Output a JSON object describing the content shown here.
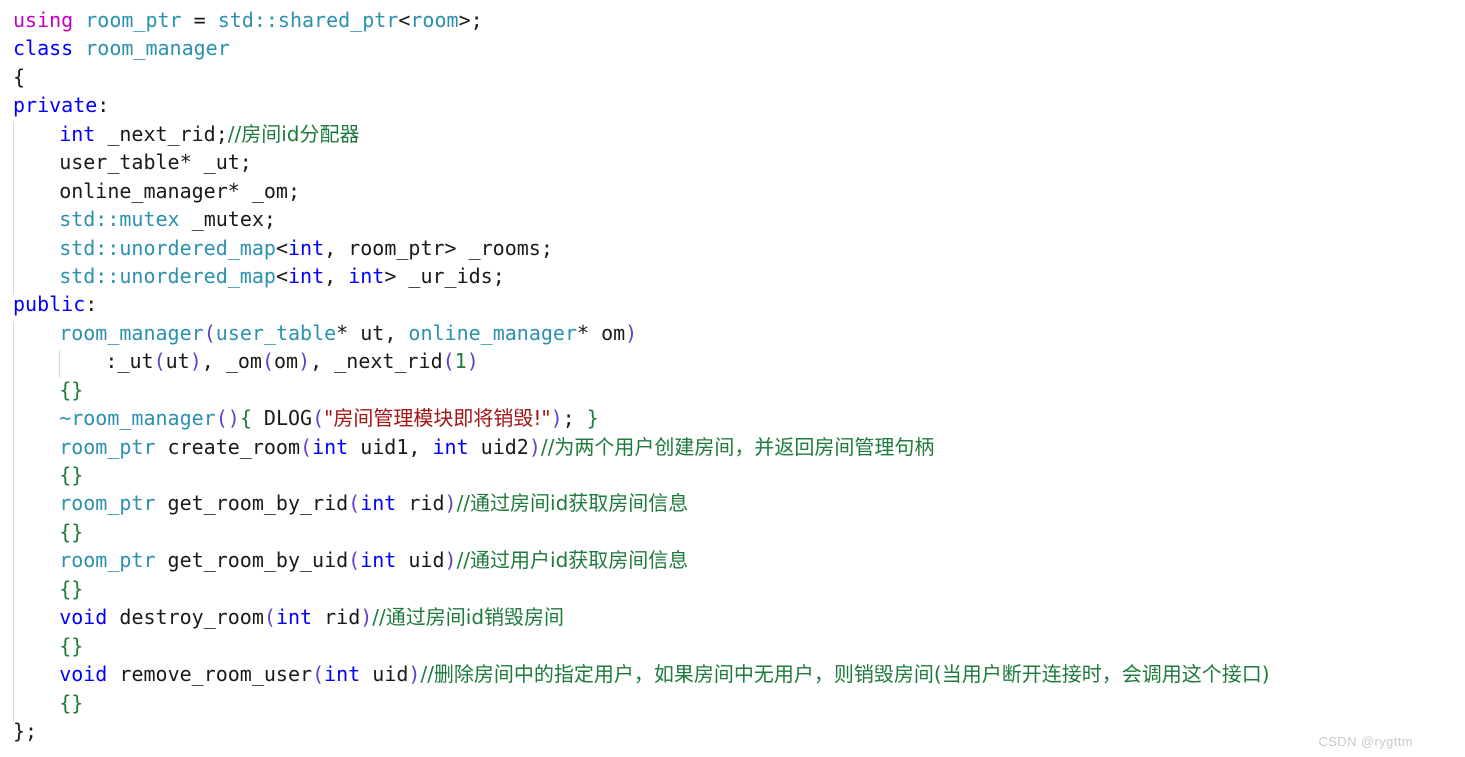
{
  "editor": {
    "language": "cpp",
    "background": "#ffffff",
    "colors": {
      "keyword": "#0000ff",
      "using_keyword": "#c500c5",
      "type": "#2b91af",
      "identifier": "#1a1a1a",
      "comment": "#1f7a3d",
      "string": "#a31515",
      "number": "#1f7a3d",
      "paren": "#5f41c9",
      "brace": "#1f7a3d",
      "indent_guide": "#d7d7d7",
      "watermark": "#c9c9c9"
    },
    "lines": [
      {
        "n": 1,
        "indent": 0,
        "tokens": [
          {
            "t": "using",
            "c": "kw-using"
          },
          {
            "t": " ",
            "c": "op"
          },
          {
            "t": "room_ptr",
            "c": "type"
          },
          {
            "t": " = ",
            "c": "punct"
          },
          {
            "t": "std::shared_ptr",
            "c": "type"
          },
          {
            "t": "<",
            "c": "punct"
          },
          {
            "t": "room",
            "c": "type"
          },
          {
            "t": ">;",
            "c": "punct"
          }
        ]
      },
      {
        "n": 2,
        "indent": 0,
        "tokens": [
          {
            "t": "class",
            "c": "kw"
          },
          {
            "t": " ",
            "c": "op"
          },
          {
            "t": "room_manager",
            "c": "type"
          }
        ]
      },
      {
        "n": 3,
        "indent": 0,
        "tokens": [
          {
            "t": "{",
            "c": "punct"
          }
        ]
      },
      {
        "n": 4,
        "indent": 0,
        "tokens": [
          {
            "t": "private",
            "c": "kw"
          },
          {
            "t": ":",
            "c": "punct"
          }
        ]
      },
      {
        "n": 5,
        "indent": 1,
        "tokens": [
          {
            "t": "int",
            "c": "kw"
          },
          {
            "t": " _next_rid;",
            "c": "id"
          },
          {
            "t": "//房间id分配器",
            "c": "cmt cjk"
          }
        ]
      },
      {
        "n": 6,
        "indent": 1,
        "tokens": [
          {
            "t": "user_table* _ut;",
            "c": "id"
          }
        ]
      },
      {
        "n": 7,
        "indent": 1,
        "tokens": [
          {
            "t": "online_manager* _om;",
            "c": "id"
          }
        ]
      },
      {
        "n": 8,
        "indent": 1,
        "tokens": [
          {
            "t": "std::mutex",
            "c": "type"
          },
          {
            "t": " _mutex;",
            "c": "id"
          }
        ]
      },
      {
        "n": 9,
        "indent": 1,
        "tokens": [
          {
            "t": "std::unordered_map",
            "c": "type"
          },
          {
            "t": "<",
            "c": "punct"
          },
          {
            "t": "int",
            "c": "kw"
          },
          {
            "t": ", room_ptr> _rooms;",
            "c": "id"
          }
        ]
      },
      {
        "n": 10,
        "indent": 1,
        "tokens": [
          {
            "t": "std::unordered_map",
            "c": "type"
          },
          {
            "t": "<",
            "c": "punct"
          },
          {
            "t": "int",
            "c": "kw"
          },
          {
            "t": ", ",
            "c": "id"
          },
          {
            "t": "int",
            "c": "kw"
          },
          {
            "t": "> _ur_ids;",
            "c": "id"
          }
        ]
      },
      {
        "n": 11,
        "indent": 0,
        "tokens": [
          {
            "t": "public",
            "c": "kw"
          },
          {
            "t": ":",
            "c": "punct"
          }
        ]
      },
      {
        "n": 12,
        "indent": 1,
        "tokens": [
          {
            "t": "room_manager",
            "c": "type"
          },
          {
            "t": "(",
            "c": "paren"
          },
          {
            "t": "user_table",
            "c": "type"
          },
          {
            "t": "* ut, ",
            "c": "id"
          },
          {
            "t": "online_manager",
            "c": "type"
          },
          {
            "t": "* om",
            "c": "id"
          },
          {
            "t": ")",
            "c": "paren"
          }
        ]
      },
      {
        "n": 13,
        "indent": 2,
        "tokens": [
          {
            "t": ":_ut",
            "c": "id"
          },
          {
            "t": "(",
            "c": "paren"
          },
          {
            "t": "ut",
            "c": "id"
          },
          {
            "t": ")",
            "c": "paren"
          },
          {
            "t": ", _om",
            "c": "id"
          },
          {
            "t": "(",
            "c": "paren"
          },
          {
            "t": "om",
            "c": "id"
          },
          {
            "t": ")",
            "c": "paren"
          },
          {
            "t": ", _next_rid",
            "c": "id"
          },
          {
            "t": "(",
            "c": "paren"
          },
          {
            "t": "1",
            "c": "num"
          },
          {
            "t": ")",
            "c": "paren"
          }
        ]
      },
      {
        "n": 14,
        "indent": 1,
        "tokens": [
          {
            "t": "{}",
            "c": "brace-g"
          }
        ]
      },
      {
        "n": 15,
        "indent": 1,
        "tokens": [
          {
            "t": "~room_manager",
            "c": "type"
          },
          {
            "t": "(",
            "c": "paren"
          },
          {
            "t": ")",
            "c": "paren"
          },
          {
            "t": "{",
            "c": "brace-g"
          },
          {
            "t": " DLOG",
            "c": "id"
          },
          {
            "t": "(",
            "c": "paren"
          },
          {
            "t": "\"房间管理模块即将销毁!\"",
            "c": "str cjk"
          },
          {
            "t": ")",
            "c": "paren"
          },
          {
            "t": "; ",
            "c": "id"
          },
          {
            "t": "}",
            "c": "brace-g"
          }
        ]
      },
      {
        "n": 16,
        "indent": 1,
        "tokens": [
          {
            "t": "room_ptr",
            "c": "type"
          },
          {
            "t": " create_room",
            "c": "id"
          },
          {
            "t": "(",
            "c": "paren"
          },
          {
            "t": "int",
            "c": "kw"
          },
          {
            "t": " uid1, ",
            "c": "id"
          },
          {
            "t": "int",
            "c": "kw"
          },
          {
            "t": " uid2",
            "c": "id"
          },
          {
            "t": ")",
            "c": "paren"
          },
          {
            "t": "//为两个用户创建房间，并返回房间管理句柄",
            "c": "cmt cjk"
          }
        ]
      },
      {
        "n": 17,
        "indent": 1,
        "tokens": [
          {
            "t": "{}",
            "c": "brace-g"
          }
        ]
      },
      {
        "n": 18,
        "indent": 1,
        "tokens": [
          {
            "t": "room_ptr",
            "c": "type"
          },
          {
            "t": " get_room_by_rid",
            "c": "id"
          },
          {
            "t": "(",
            "c": "paren"
          },
          {
            "t": "int",
            "c": "kw"
          },
          {
            "t": " rid",
            "c": "id"
          },
          {
            "t": ")",
            "c": "paren"
          },
          {
            "t": "//通过房间id获取房间信息",
            "c": "cmt cjk"
          }
        ]
      },
      {
        "n": 19,
        "indent": 1,
        "tokens": [
          {
            "t": "{}",
            "c": "brace-g"
          }
        ]
      },
      {
        "n": 20,
        "indent": 1,
        "tokens": [
          {
            "t": "room_ptr",
            "c": "type"
          },
          {
            "t": " get_room_by_uid",
            "c": "id"
          },
          {
            "t": "(",
            "c": "paren"
          },
          {
            "t": "int",
            "c": "kw"
          },
          {
            "t": " uid",
            "c": "id"
          },
          {
            "t": ")",
            "c": "paren"
          },
          {
            "t": "//通过用户id获取房间信息",
            "c": "cmt cjk"
          }
        ]
      },
      {
        "n": 21,
        "indent": 1,
        "tokens": [
          {
            "t": "{}",
            "c": "brace-g"
          }
        ]
      },
      {
        "n": 22,
        "indent": 1,
        "tokens": [
          {
            "t": "void",
            "c": "kw"
          },
          {
            "t": " destroy_room",
            "c": "id"
          },
          {
            "t": "(",
            "c": "paren"
          },
          {
            "t": "int",
            "c": "kw"
          },
          {
            "t": " rid",
            "c": "id"
          },
          {
            "t": ")",
            "c": "paren"
          },
          {
            "t": "//通过房间id销毁房间",
            "c": "cmt cjk"
          }
        ]
      },
      {
        "n": 23,
        "indent": 1,
        "tokens": [
          {
            "t": "{}",
            "c": "brace-g"
          }
        ]
      },
      {
        "n": 24,
        "indent": 1,
        "tokens": [
          {
            "t": "void",
            "c": "kw"
          },
          {
            "t": " remove_room_user",
            "c": "id"
          },
          {
            "t": "(",
            "c": "paren"
          },
          {
            "t": "int",
            "c": "kw"
          },
          {
            "t": " uid",
            "c": "id"
          },
          {
            "t": ")",
            "c": "paren"
          },
          {
            "t": "//删除房间中的指定用户，如果房间中无用户，则销毁房间(当用户断开连接时，会调用这个接口)",
            "c": "cmt cjk"
          }
        ]
      },
      {
        "n": 25,
        "indent": 1,
        "tokens": [
          {
            "t": "{}",
            "c": "brace-g"
          }
        ]
      },
      {
        "n": 26,
        "indent": 0,
        "tokens": [
          {
            "t": "};",
            "c": "punct"
          }
        ]
      }
    ]
  },
  "watermark": {
    "text": "CSDN @rygttm"
  }
}
